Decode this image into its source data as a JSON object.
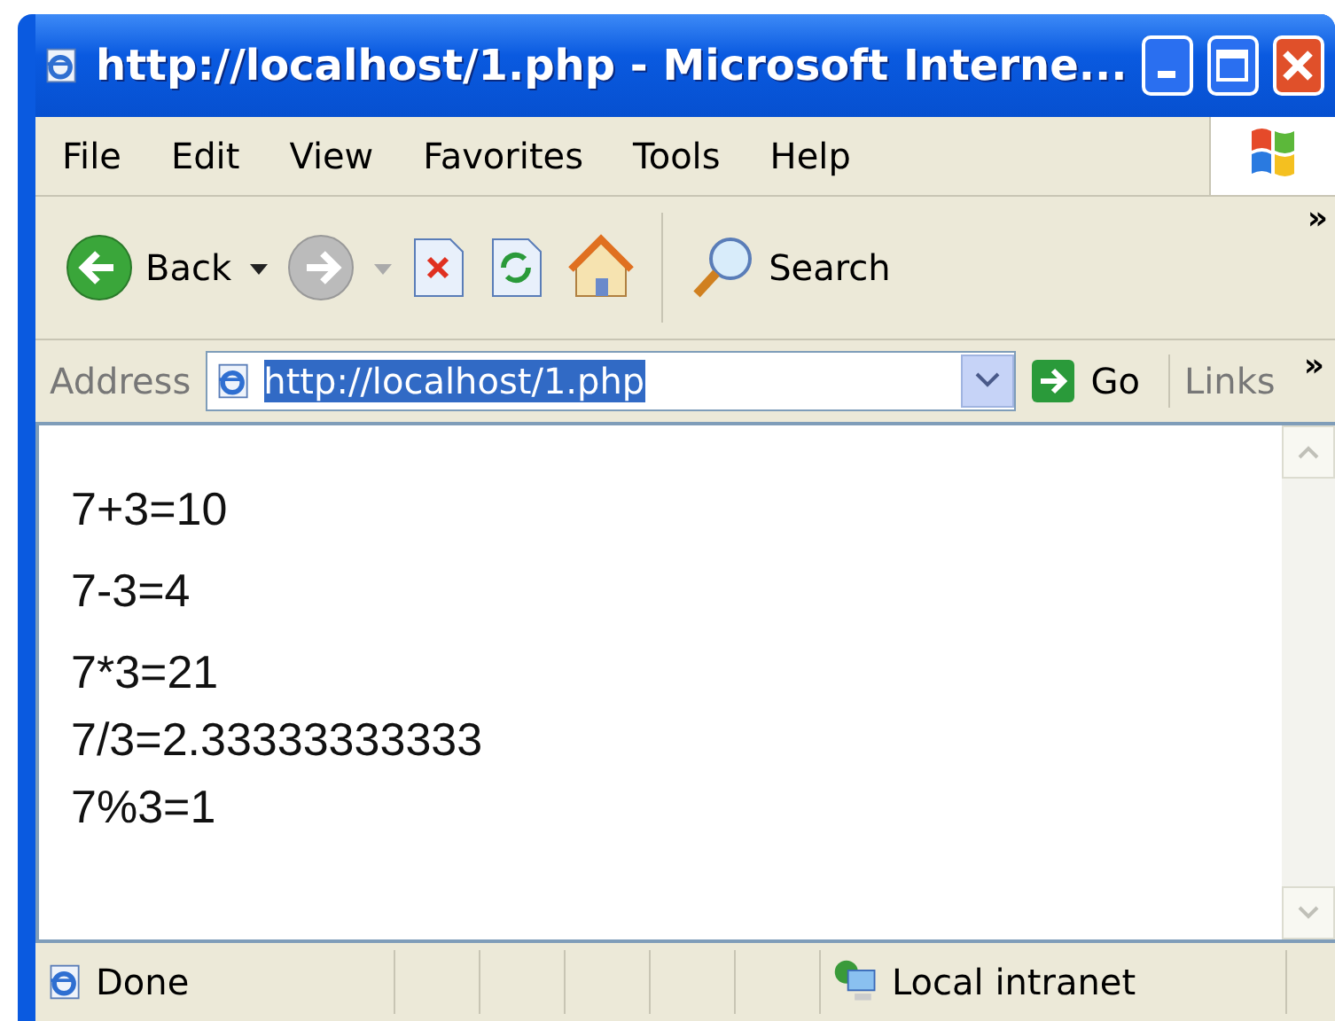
{
  "window": {
    "title": "http://localhost/1.php - Microsoft Interne..."
  },
  "menu": [
    "File",
    "Edit",
    "View",
    "Favorites",
    "Tools",
    "Help"
  ],
  "toolbar": {
    "back": "Back",
    "search": "Search",
    "more": "»"
  },
  "address": {
    "label": "Address",
    "value": "http://localhost/1.php",
    "selected": true,
    "go": "Go",
    "links": "Links",
    "more": "»"
  },
  "content": [
    {
      "lines": [
        "7+3=10"
      ]
    },
    {
      "lines": [
        "7-3=4"
      ]
    },
    {
      "lines": [
        "7*3=21",
        "7/3=2.33333333333",
        "7%3=1"
      ]
    }
  ],
  "status_bar": {
    "text": "Done",
    "zone": "Local intranet"
  }
}
